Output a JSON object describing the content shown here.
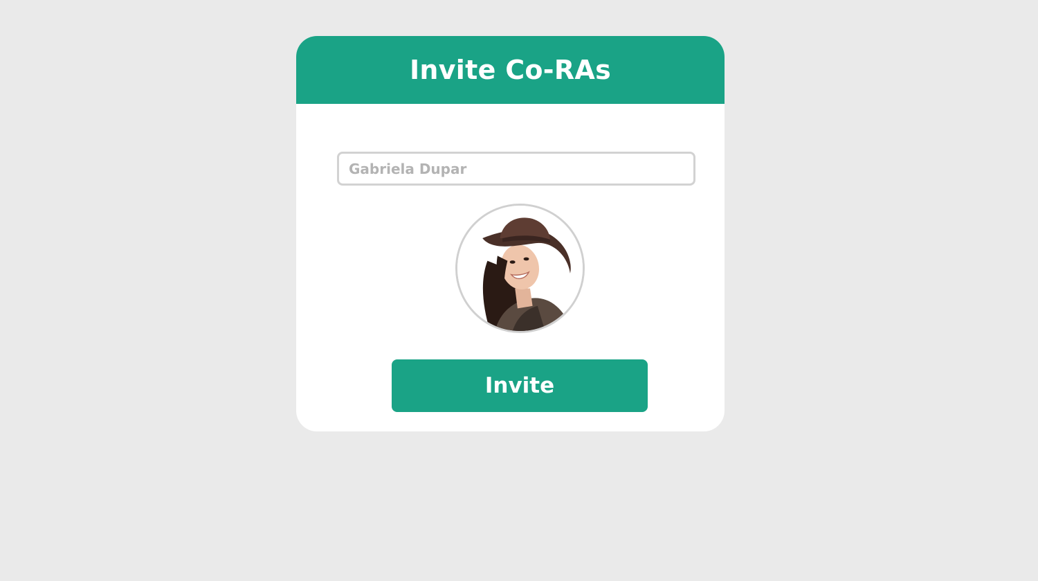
{
  "header": {
    "title": "Invite Co-RAs"
  },
  "form": {
    "name_placeholder": "Gabriela Dupar",
    "avatar_icon": "user-avatar-photo",
    "invite_label": "Invite"
  },
  "colors": {
    "accent": "#1aa386",
    "background": "#eaeaea",
    "card": "#ffffff",
    "input_border": "#d2d2d2"
  }
}
